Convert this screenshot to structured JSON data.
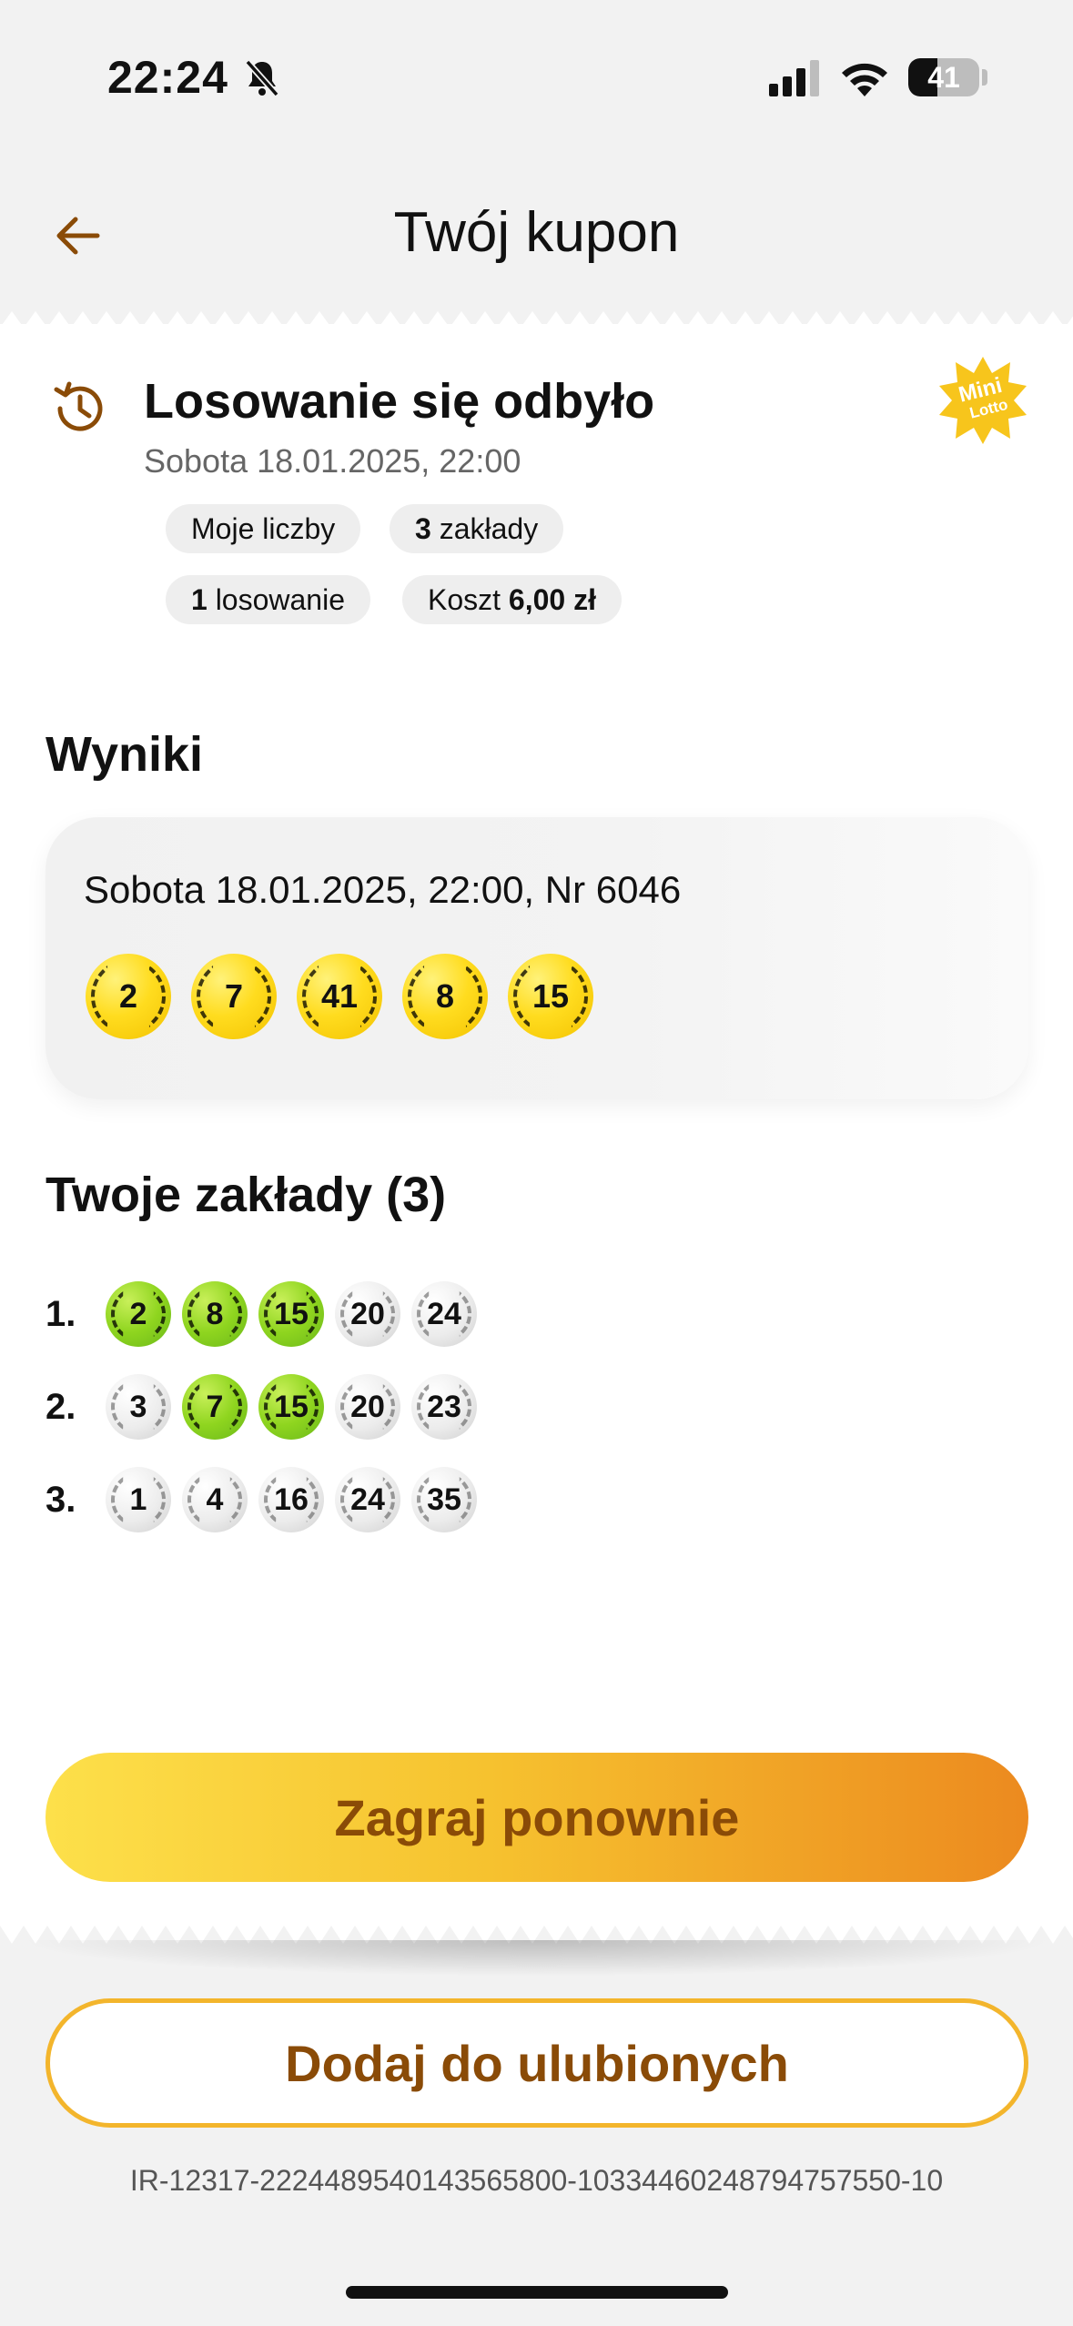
{
  "status_bar": {
    "time": "22:24",
    "battery": "41",
    "battery_level": 0.41
  },
  "header": {
    "title": "Twój kupon"
  },
  "draw": {
    "status": "Losowanie się odbyło",
    "date": "Sobota 18.01.2025, 22:00",
    "logo_text_1": "Mini",
    "logo_text_2": "Lotto"
  },
  "chips": {
    "my_numbers": "Moje liczby",
    "bets_count": "3",
    "bets_label": " zakłady",
    "draws_count": "1",
    "draws_label": " losowanie",
    "cost_label": "Koszt ",
    "cost_value": "6,00 zł"
  },
  "results": {
    "title": "Wyniki",
    "label": "Sobota 18.01.2025, 22:00, Nr 6046",
    "numbers": [
      "2",
      "7",
      "41",
      "8",
      "15"
    ]
  },
  "bets": {
    "title": "Twoje zakłady (3)",
    "rows": [
      {
        "index": "1.",
        "balls": [
          {
            "n": "2",
            "hit": true
          },
          {
            "n": "8",
            "hit": true
          },
          {
            "n": "15",
            "hit": true
          },
          {
            "n": "20",
            "hit": false
          },
          {
            "n": "24",
            "hit": false
          }
        ]
      },
      {
        "index": "2.",
        "balls": [
          {
            "n": "3",
            "hit": false
          },
          {
            "n": "7",
            "hit": true
          },
          {
            "n": "15",
            "hit": true
          },
          {
            "n": "20",
            "hit": false
          },
          {
            "n": "23",
            "hit": false
          }
        ]
      },
      {
        "index": "3.",
        "balls": [
          {
            "n": "1",
            "hit": false
          },
          {
            "n": "4",
            "hit": false
          },
          {
            "n": "16",
            "hit": false
          },
          {
            "n": "24",
            "hit": false
          },
          {
            "n": "35",
            "hit": false
          }
        ]
      }
    ]
  },
  "actions": {
    "play_again": "Zagraj ponownie",
    "add_favorite": "Dodaj do ulubionych"
  },
  "coupon_id": "IR-12317-2224489540143565800-10334460248794757550-10",
  "colors": {
    "accent_brown": "#8a4b07",
    "hit_green": "#8fd51f",
    "ball_yellow": "#ffdc1f"
  }
}
